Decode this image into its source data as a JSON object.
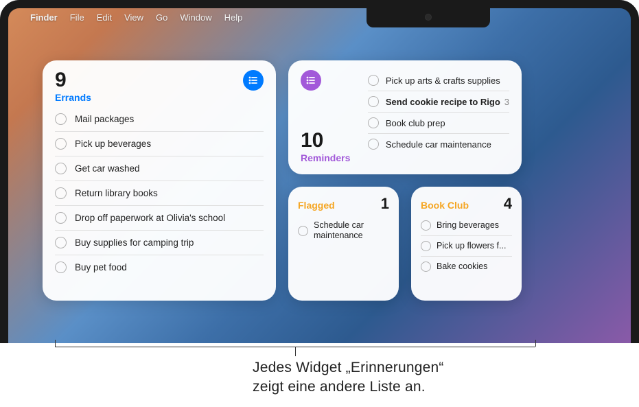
{
  "menubar": {
    "apple": "",
    "app": "Finder",
    "items": [
      "File",
      "Edit",
      "View",
      "Go",
      "Window",
      "Help"
    ]
  },
  "colors": {
    "errands": "#007aff",
    "reminders": "#a259d9",
    "flagged": "#f5a623",
    "bookclub": "#f5a623"
  },
  "widgets": {
    "errands": {
      "count": "9",
      "label": "Errands",
      "items": [
        {
          "text": "Mail packages"
        },
        {
          "text": "Pick up beverages"
        },
        {
          "text": "Get car washed"
        },
        {
          "text": "Return library books"
        },
        {
          "text": "Drop off paperwork at Olivia's school"
        },
        {
          "text": "Buy supplies for camping trip"
        },
        {
          "text": "Buy pet food"
        }
      ]
    },
    "reminders": {
      "count": "10",
      "label": "Reminders",
      "items": [
        {
          "text": "Pick up arts & crafts supplies"
        },
        {
          "text": "Send cookie recipe to Rigo",
          "bold": true,
          "suffix": "3"
        },
        {
          "text": "Book club prep"
        },
        {
          "text": "Schedule car maintenance"
        }
      ]
    },
    "flagged": {
      "label": "Flagged",
      "count": "1",
      "items": [
        {
          "text": "Schedule car maintenance"
        }
      ]
    },
    "bookclub": {
      "label": "Book Club",
      "count": "4",
      "items": [
        {
          "text": "Bring beverages"
        },
        {
          "text": "Pick up flowers f..."
        },
        {
          "text": "Bake cookies"
        }
      ]
    }
  },
  "caption": {
    "line1": "Jedes Widget „Erinnerungen“",
    "line2": "zeigt eine andere Liste an."
  }
}
